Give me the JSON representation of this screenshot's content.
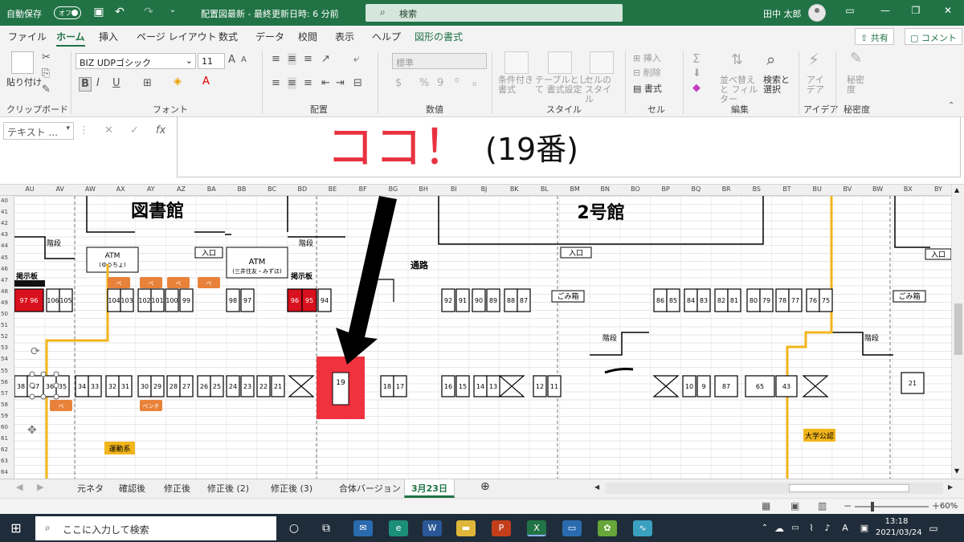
{
  "titlebar": {
    "autosave": "自動保存",
    "autosave_toggle": "オフ",
    "document": "配置図最新 - 最終更新日時: 6 分前",
    "search": "検索",
    "user": "田中 太郎"
  },
  "ribbon_tabs": [
    "ファイル",
    "ホーム",
    "挿入",
    "ページ レイアウト",
    "数式",
    "データ",
    "校閲",
    "表示",
    "ヘルプ",
    "図形の書式"
  ],
  "share_button": "共有",
  "comment_button": "コメント",
  "ribbon": {
    "clipboard": {
      "paste": "貼り付け",
      "label": "クリップボード"
    },
    "font": {
      "name": "BIZ UDPゴシック",
      "size": "11",
      "label": "フォント",
      "bold": "B",
      "italic": "I",
      "underline": "U"
    },
    "alignment": {
      "label": "配置"
    },
    "number": {
      "format": "標準",
      "label": "数値"
    },
    "styles": {
      "conditional": "条件付き 書式",
      "table": "テーブルとして 書式設定",
      "cell": "セルの スタイル",
      "label": "スタイル"
    },
    "cells": {
      "insert": "挿入",
      "delete": "削除",
      "format": "書式",
      "label": "セル"
    },
    "editing": {
      "sort": "並べ替えと フィルター",
      "find": "検索と 選択",
      "label": "編集"
    },
    "ideas": {
      "button": "アイ デア",
      "label": "アイデア"
    },
    "sensitivity": {
      "button": "秘密度",
      "label": "秘密度"
    }
  },
  "formula_bar": {
    "name_box": "テキスト ...",
    "content_highlight": "ココ！",
    "content_rest": "(19番)"
  },
  "columns": [
    "AU",
    "AV",
    "AW",
    "AX",
    "AY",
    "AZ",
    "BA",
    "BB",
    "BC",
    "BD",
    "BE",
    "BF",
    "BG",
    "BH",
    "BI",
    "BJ",
    "BK",
    "BL",
    "BM",
    "BN",
    "BO",
    "BP",
    "BQ",
    "BR",
    "BS",
    "BT",
    "BU",
    "BV",
    "BW",
    "BX",
    "BY"
  ],
  "rows": [
    "40",
    "41",
    "42",
    "43",
    "44",
    "45",
    "46",
    "47",
    "48",
    "49",
    "50",
    "51",
    "52",
    "53",
    "54",
    "55",
    "56",
    "57",
    "58",
    "59",
    "60",
    "61",
    "62",
    "63",
    "64"
  ],
  "map": {
    "library": "図書館",
    "building2": "2号館",
    "stairs": "階段",
    "entrance": "入口",
    "atm1": "ATM",
    "atm1_sub": "(ゆうちょ)",
    "atm2": "ATM",
    "atm2_sub": "(三井住友・みずほ)",
    "board": "掲示板",
    "passage": "通路",
    "trash": "ごみ箱",
    "bench": "ベ",
    "bench_full": "ベンチ",
    "sports": "運動系",
    "university": "大学公認",
    "target_seat": "19"
  },
  "sheet_tabs": [
    "元ネタ",
    "確認後",
    "修正後",
    "修正後 (2)",
    "修正後 (3)",
    "合体バージョン",
    "3月23日"
  ],
  "status": {
    "zoom": "60%"
  },
  "taskbar": {
    "search": "ここに入力して検索",
    "time": "13:18",
    "date": "2021/03/24"
  },
  "colors": {
    "excel_green": "#217346",
    "highlight_red": "#e8323f",
    "bench_orange": "#e8823a",
    "route_yellow": "#f2b51c",
    "seat_red": "#d9101d"
  }
}
